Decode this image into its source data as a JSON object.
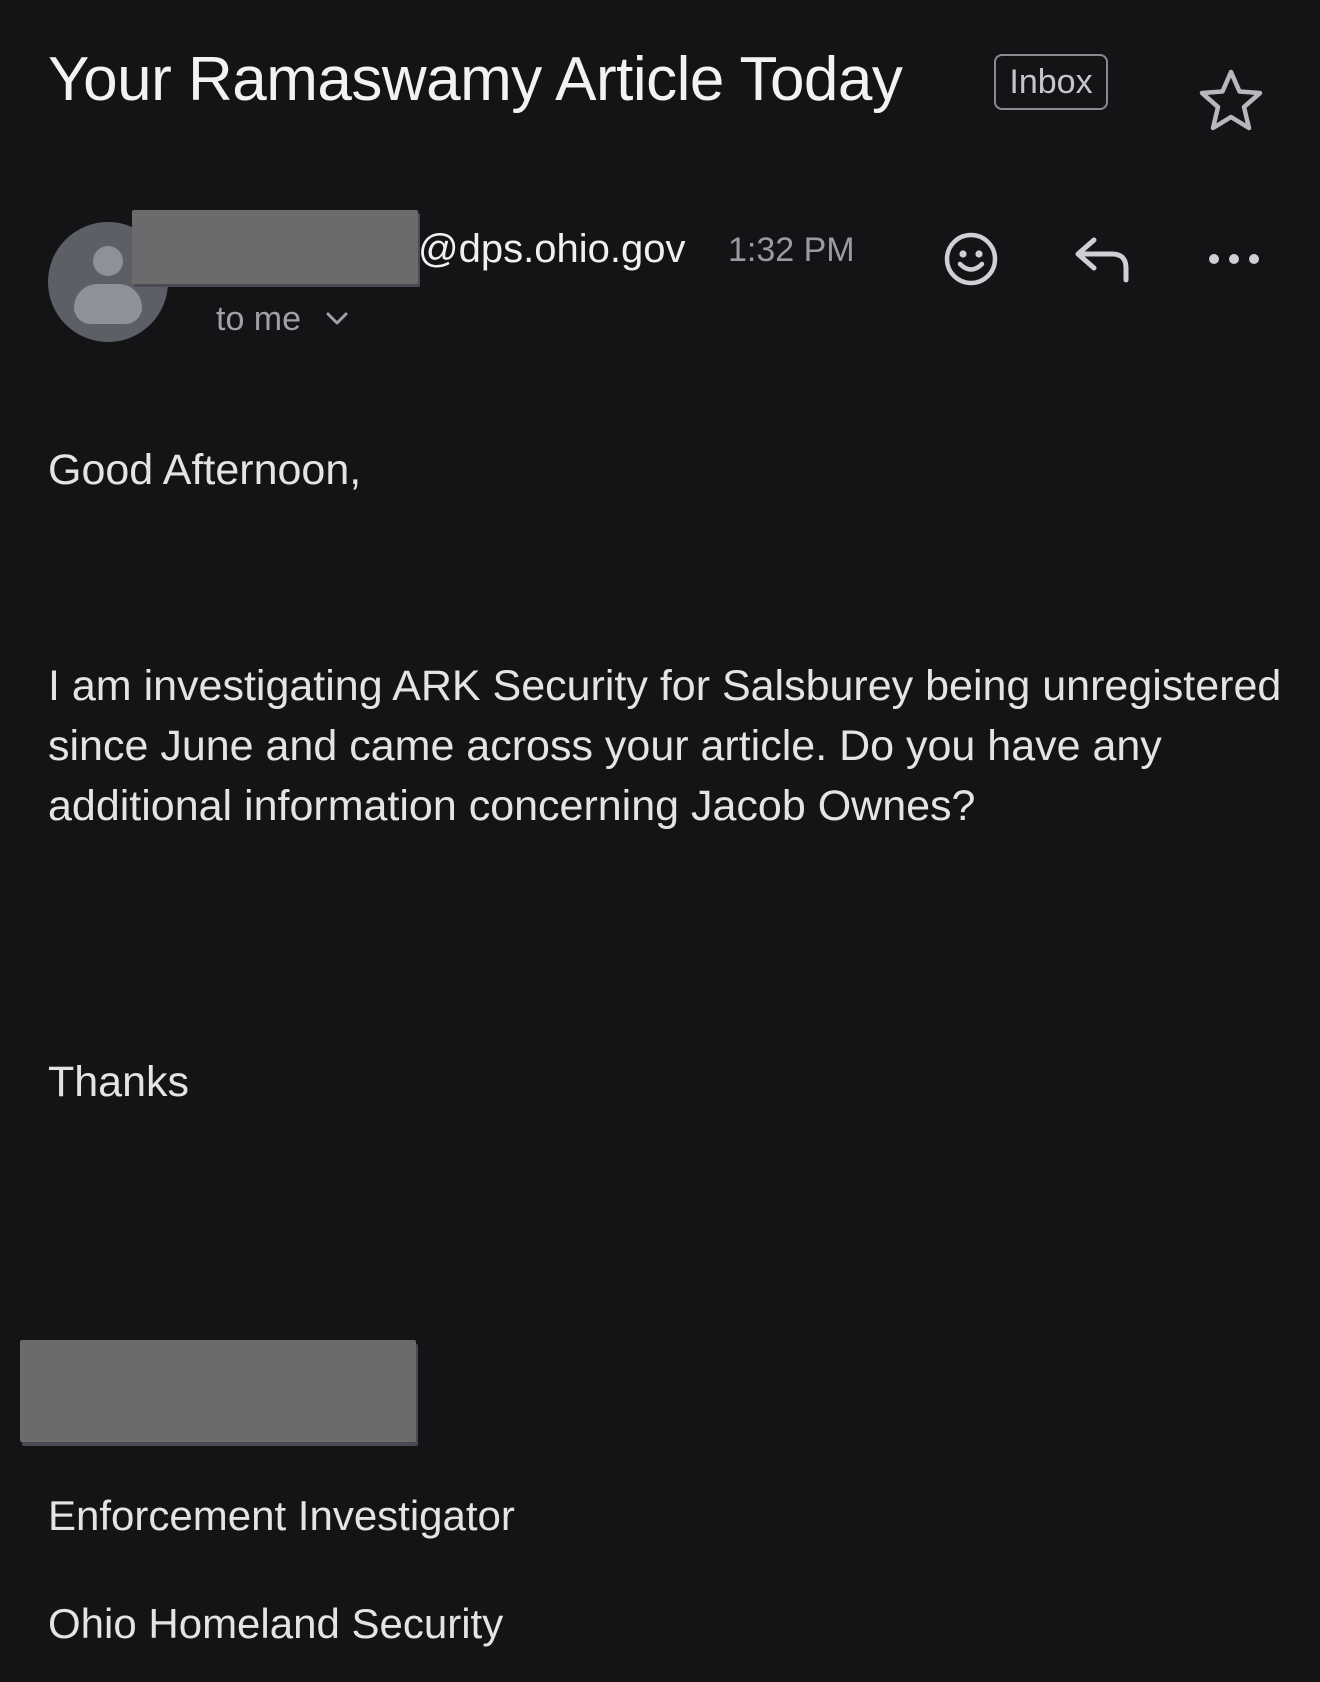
{
  "header": {
    "subject": "Your Ramaswamy Article Today",
    "label": "Inbox",
    "star_icon": "star-outline-icon"
  },
  "sender": {
    "avatar_icon": "default-person-avatar-icon",
    "domain": "@dps.ohio.gov",
    "time": "1:32 PM",
    "recipient_text": "to me",
    "expand_icon": "chevron-down-icon"
  },
  "actions": {
    "emoji_icon": "smiley-face-icon",
    "reply_icon": "reply-arrow-icon",
    "more_icon": "more-horizontal-icon"
  },
  "message": {
    "greeting": "Good Afternoon,",
    "paragraph": "I am investigating ARK Security for Salsburey being unregistered since June and came across your article. Do you have any additional information concerning Jacob Ownes?",
    "closing": "Thanks"
  },
  "signature": {
    "title": "Enforcement Investigator",
    "organization": "Ohio Homeland Security"
  },
  "colors": {
    "background": "#141416",
    "text": "#e8e8ea",
    "muted": "#9a9aa0",
    "redaction": "#6b6b6e"
  }
}
